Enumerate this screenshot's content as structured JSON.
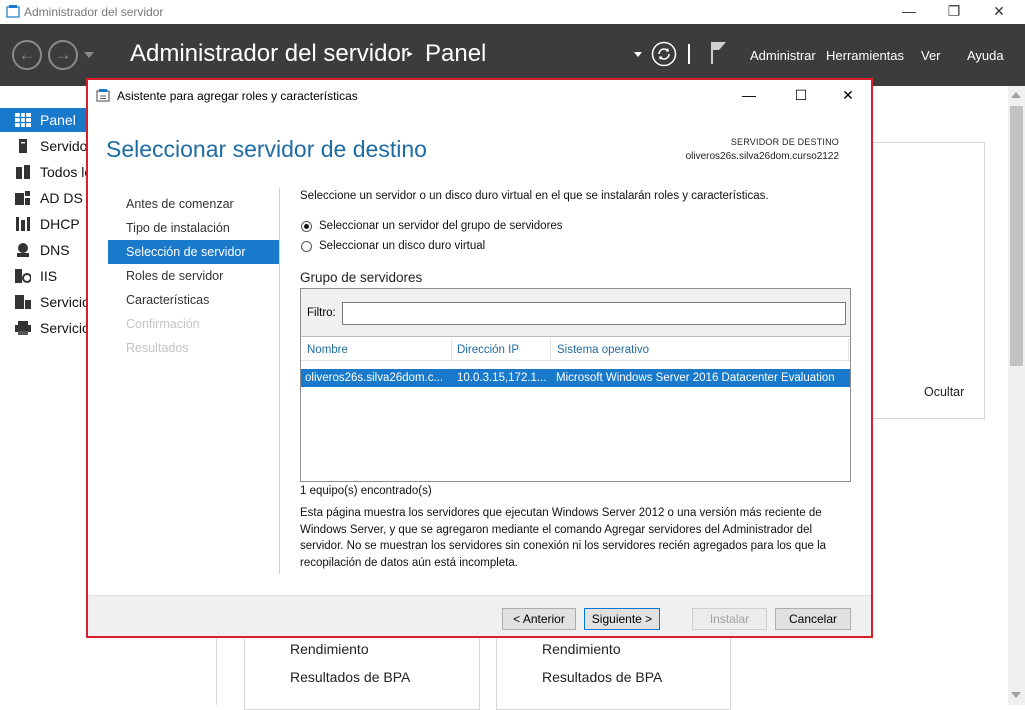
{
  "window": {
    "title": "Administrador del servidor",
    "minimize_glyph": "—",
    "restore_glyph": "❐",
    "close_glyph": "✕"
  },
  "header": {
    "title": "Administrador del servidor",
    "separator": "‣",
    "location": "Panel",
    "menus": [
      "Administrar",
      "Herramientas",
      "Ver",
      "Ayuda"
    ],
    "icons": [
      "back-icon",
      "forward-icon",
      "refresh-icon",
      "flag-icon"
    ]
  },
  "sidebar": {
    "items": [
      {
        "label": "Panel",
        "icon": "dashboard-icon",
        "active": true
      },
      {
        "label": "Servidor local",
        "icon": "server-icon"
      },
      {
        "label": "Todos los servidores",
        "icon": "servers-icon"
      },
      {
        "label": "AD DS",
        "icon": "ad-ds-icon"
      },
      {
        "label": "DHCP",
        "icon": "dhcp-icon"
      },
      {
        "label": "DNS",
        "icon": "dns-icon"
      },
      {
        "label": "IIS",
        "icon": "iis-icon"
      },
      {
        "label": "Servicios de archivos",
        "icon": "file-services-icon"
      },
      {
        "label": "Servicios de impresión",
        "icon": "print-services-icon"
      }
    ]
  },
  "background": {
    "hide_label": "Ocultar",
    "left_panel": [
      "Rendimiento",
      "Resultados de BPA"
    ],
    "right_panel": [
      "Rendimiento",
      "Resultados de BPA"
    ]
  },
  "dialog": {
    "title": "Asistente para agregar roles y características",
    "heading": "Seleccionar servidor de destino",
    "destination_label": "SERVIDOR DE DESTINO",
    "destination_value": "oliveros26s.silva26dom.curso2122",
    "steps": [
      {
        "label": "Antes de comenzar",
        "state": "normal"
      },
      {
        "label": "Tipo de instalación",
        "state": "normal"
      },
      {
        "label": "Selección de servidor",
        "state": "active"
      },
      {
        "label": "Roles de servidor",
        "state": "normal"
      },
      {
        "label": "Características",
        "state": "normal"
      },
      {
        "label": "Confirmación",
        "state": "disabled"
      },
      {
        "label": "Resultados",
        "state": "disabled"
      }
    ],
    "intro": "Seleccione un servidor o un disco duro virtual en el que se instalarán roles y características.",
    "options": [
      {
        "label": "Seleccionar un servidor del grupo de servidores",
        "checked": true
      },
      {
        "label": "Seleccionar un disco duro virtual",
        "checked": false
      }
    ],
    "group_title": "Grupo de servidores",
    "filter_label": "Filtro:",
    "filter_value": "",
    "columns": [
      "Nombre",
      "Dirección IP",
      "Sistema operativo"
    ],
    "rows": [
      {
        "name": "oliveros26s.silva26dom.c...",
        "ip": "10.0.3.15,172.1...",
        "os": "Microsoft Windows Server 2016 Datacenter Evaluation"
      }
    ],
    "count_text": "1 equipo(s) encontrado(s)",
    "note_lines": [
      "Esta página muestra los servidores que ejecutan Windows Server 2012 o una versión más reciente de",
      "Windows Server, y que se agregaron mediante el comando Agregar servidores del Administrador del",
      "servidor. No se muestran los servidores sin conexión ni los servidores recién agregados para los que la",
      "recopilación de datos aún está incompleta."
    ],
    "buttons": {
      "previous": "< Anterior",
      "next": "Siguiente >",
      "install": "Instalar",
      "cancel": "Cancelar"
    },
    "minimize_glyph": "—",
    "maximize_glyph": "☐",
    "close_glyph": "✕"
  },
  "colors": {
    "accent": "#1979ca",
    "header_bg": "#3c3c3c",
    "dialog_border": "#d4202a",
    "heading": "#1f6ba3"
  }
}
